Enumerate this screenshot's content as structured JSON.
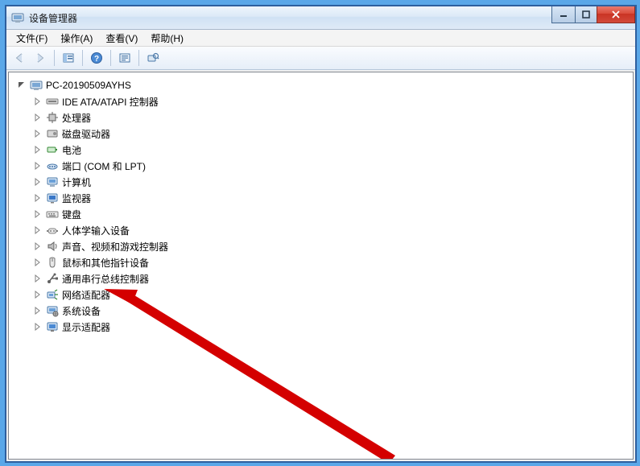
{
  "window": {
    "title": "设备管理器"
  },
  "menubar": {
    "file": "文件(F)",
    "action": "操作(A)",
    "view": "查看(V)",
    "help": "帮助(H)"
  },
  "tree": {
    "root": "PC-20190509AYHS",
    "items": [
      "IDE ATA/ATAPI 控制器",
      "处理器",
      "磁盘驱动器",
      "电池",
      "端口 (COM 和 LPT)",
      "计算机",
      "监视器",
      "键盘",
      "人体学输入设备",
      "声音、视频和游戏控制器",
      "鼠标和其他指针设备",
      "通用串行总线控制器",
      "网络适配器",
      "系统设备",
      "显示适配器"
    ]
  }
}
